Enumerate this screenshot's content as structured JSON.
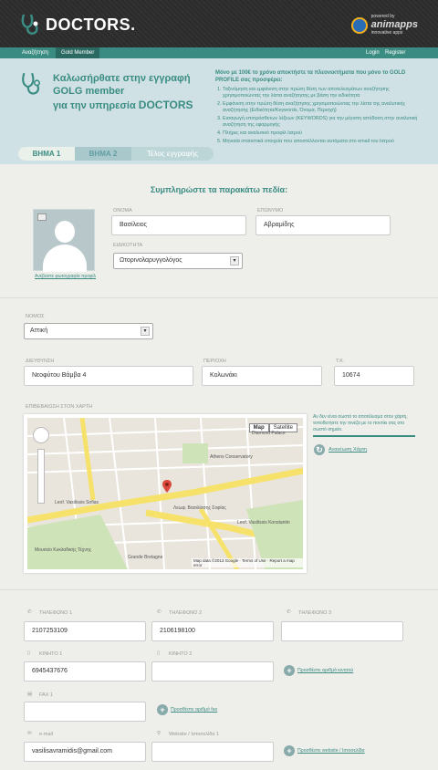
{
  "header": {
    "logo_text": "DOCTORS.",
    "powered_small": "powered by",
    "powered_brand": "animapps",
    "powered_sub": "innovative apps"
  },
  "nav": {
    "left": [
      "Αναζήτηση",
      "Gold Member"
    ],
    "right": [
      "Login",
      "Register"
    ]
  },
  "banner": {
    "line1": "Καλωσήρθατε στην εγγραφή",
    "line2": "GOLG member",
    "line3_a": "για την υπηρεσία",
    "line3_b": "DOCTORS",
    "intro": "Μόνο με 100€ το χρόνο αποκτήστε τα πλεονεκτήματα που μόνο το GOLD PROFILE σας προσφέρει:",
    "benefits": [
      "Ταξινόμηση και εμφάνιση στην πρώτη θέση των αποτελεσμάτων αναζήτησης χρησιμοποιώντας την λίστα αναζήτησης με βάση την ειδικότητα",
      "Εμφάνιση στην πρώτη θέση αναζήτησης χρησιμοποιώντας την λίστα της αναλυτικής αναζήτησης (Ειδικότητα/Keywords, Όνομα, Περιοχή)",
      "Εισαγωγή επιπρόσθετων λέξεων (KEYWORDS) για την μέγιστη απόδοση στην αναλυτική αναζήτηση της εφαρμογής",
      "Πλήρες και αναλυτικό προφίλ Ιατρού",
      "Μηνιαία στατιστικά στοιχεία που αποστέλλονται αυτόματα στο email του Ιατρού"
    ]
  },
  "steps": [
    "ΒΗΜΑ 1",
    "ΒΗΜΑ 2",
    "Τέλος εγγραφής"
  ],
  "form": {
    "title": "Συμπληρώστε τα παρακάτω πεδία:",
    "photo_link": "Ανέβαστε φωτογραφία προφίλ",
    "name_label": "ΟΝΟΜΑ",
    "name_value": "Βασίλειος",
    "surname_label": "ΕΠΩΝΥΜΟ",
    "surname_value": "Αβραμίδης",
    "specialty_label": "ΕΙΔΙΚΟΤΗΤΑ",
    "specialty_value": "Ωτορινολαρυγγολόγος",
    "prefecture_label": "ΝΟΜΟΣ",
    "prefecture_value": "Αττική",
    "address_label": "ΔΙΕΥΘΥΝΣΗ",
    "address_value": "Νεοφύτου Βάμβα 4",
    "area_label": "ΠΕΡΙΟΧΗ",
    "area_value": "Κολωνάκι",
    "zip_label": "Τ.Κ.",
    "zip_value": "10674",
    "map_label": "ΕΠΙΒΕΒΑΙΩΣΗ ΣΤΟΝ ΧΑΡΤΗ",
    "map_help": "Αν δεν είναι σωστό το αποτέλεσμα στον χάρτη, τοποθετήστε την πινέζα με το ποντίκι σας στο σωστό σημείο.",
    "map_refresh": "Ανανέωση Χάρτη",
    "phone1_label": "ΤΗΛΕΦΩΝΟ 1",
    "phone1_value": "2107253109",
    "phone2_label": "ΤΗΛΕΦΩΝΟ 2",
    "phone2_value": "2106198100",
    "phone3_label": "ΤΗΛΕΦΩΝΟ 3",
    "phone3_value": "",
    "mobile1_label": "ΚΙΝΗΤΟ 1",
    "mobile1_value": "6945437676",
    "mobile2_label": "ΚΙΝΗΤΟ 2",
    "mobile2_value": "",
    "add_mobile": "Προσθέστε αριθμό κινητού",
    "fax1_label": "FAX 1",
    "fax1_value": "",
    "add_fax": "Προσθέστε αριθμό fax",
    "email_label": "e-mail",
    "email_value": "vasilisavramidis@gmail.com",
    "website_label": "Website / Ιστοσελίδα 1",
    "website_value": "",
    "add_website": "Προσθέστε website / Ιστοσελίδα"
  },
  "map": {
    "btn_map": "Map",
    "btn_satellite": "Satellite",
    "footer": "Map data ©2013 Google · Terms of Use · Report a map error",
    "labels": [
      "Leof. Vasilissis Sofias",
      "Λεωφ. Βασιλίσσης Σοφίας",
      "Leof. Vasilissis Konstantin",
      "Athens Conservatory",
      "Diamond Palace",
      "Μουσείο Κυκλαδικής Τέχνης",
      "Grande Bretagne"
    ]
  },
  "colors": {
    "accent": "#3a8c82",
    "banner_bg": "#cfe1e5",
    "header_bg": "#2b2b2b"
  }
}
